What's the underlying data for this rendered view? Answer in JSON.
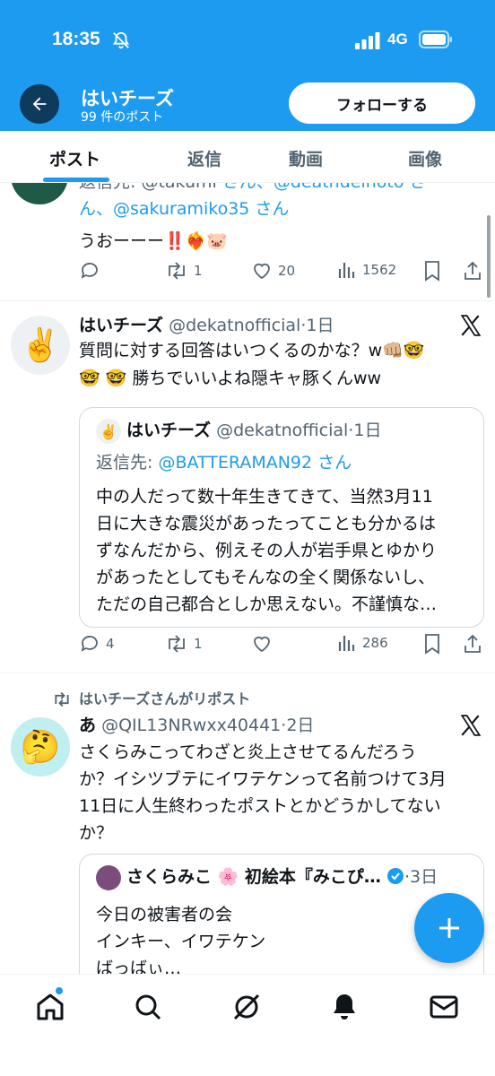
{
  "status_bar": {
    "time": "18:35",
    "network": "4G"
  },
  "header": {
    "profile_name": "はいチーズ",
    "post_count": "99 件のポスト",
    "follow_label": "フォローする"
  },
  "tabs": [
    {
      "label": "ポスト",
      "active": true
    },
    {
      "label": "返信",
      "active": false
    },
    {
      "label": "動画",
      "active": false
    },
    {
      "label": "画像",
      "active": false
    }
  ],
  "posts": [
    {
      "reply_line_partial": "返信先: @takumi",
      "reply_line2_handle": "@sakuramiko35",
      "reply_line2_suffix": " さん",
      "reply_line1_mid": " さん、@deathdeinoto",
      "reply_line1_end": " さ",
      "reply_line2_prefix": "ん、",
      "text": "うおーーー‼️❤️‍🔥🐷",
      "actions": {
        "replies": "",
        "reposts": "1",
        "likes": "20",
        "views": "1562"
      }
    },
    {
      "author_name": "はいチーズ",
      "author_handle": "@dekatnofficial",
      "time": "1日",
      "avatar_emoji": "✌️",
      "text_line1": "質問に対する回答はいつくるのかな？w👊🏼🤓",
      "text_line2": "🤓 🤓 勝ちでいいよね隠キャ豚くんww",
      "quote": {
        "avatar_emoji": "✌️",
        "author_name": "はいチーズ",
        "author_handle": "@dekatnofficial",
        "time": "1日",
        "reply_prefix": "返信先: ",
        "reply_handle": "@BATTERAMAN92",
        "reply_suffix": " さん",
        "lines": [
          "中の人だって数十年生きてきて、当然3月11",
          "日に大きな震災があったってことも分かるは",
          "ずなんだから、例えその人が岩手県とゆかり",
          "があったとしてもそんなの全く関係ないし、",
          "ただの自己都合としか思えない。不謹慎な…"
        ]
      },
      "actions": {
        "replies": "4",
        "reposts": "1",
        "likes": "",
        "views": "286"
      }
    },
    {
      "repost_label": "はいチーズさんがリポスト",
      "author_name": "あ",
      "author_handle": "@QIL13NRwxx40441",
      "time": "2日",
      "avatar_emoji": "🤔",
      "lines": [
        "さくらみこってわざと炎上させてるんだろう",
        "か？イシツブテにイワテケンって名前つけて3月",
        "11日に人生終わったポストとかどうかしてない",
        "か？"
      ],
      "quote": {
        "author_name": "さくらみこ 🌸 初絵本『みこぴ…",
        "time": "3日",
        "lines": [
          "今日の被害者の会",
          "インキー、イワテケン",
          "ばっばぃ…"
        ]
      }
    }
  ],
  "icons": {
    "back": "back-arrow-icon",
    "bell_off": "bell-off-icon",
    "home": "home-icon",
    "search": "search-icon",
    "grok": "grok-icon",
    "notifications": "bell-icon",
    "messages": "mail-icon",
    "compose": "plus-icon"
  },
  "colors": {
    "brand": "#1d9bf0",
    "text": "#0f1419",
    "muted": "#536471"
  }
}
